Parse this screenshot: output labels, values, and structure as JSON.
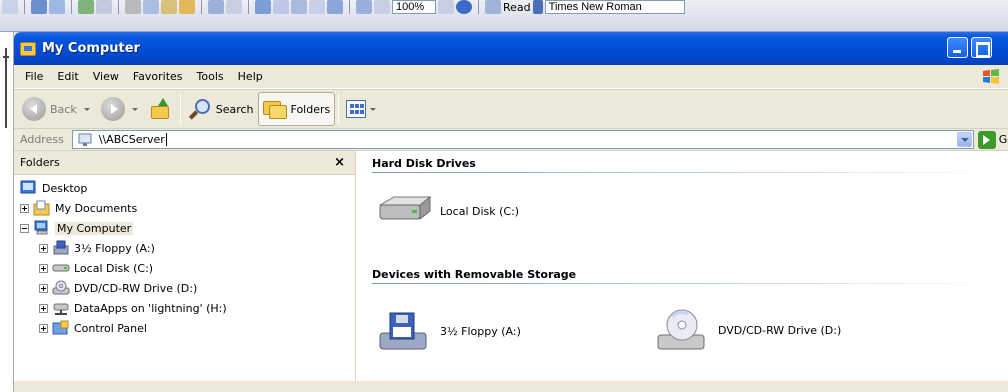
{
  "word_toolbar": {
    "zoom": "100%",
    "read_label": "Read",
    "font_box": "Times New Roman"
  },
  "window": {
    "title": "My Computer"
  },
  "menu": [
    "File",
    "Edit",
    "View",
    "Favorites",
    "Tools",
    "Help"
  ],
  "toolbar": {
    "back": "Back",
    "search": "Search",
    "folders": "Folders"
  },
  "address": {
    "label": "Address",
    "value": "\\\\ABCServer",
    "go": "Go"
  },
  "folders_pane": {
    "title": "Folders",
    "close": "×",
    "tree": [
      {
        "label": "Desktop"
      },
      {
        "label": "My Documents"
      },
      {
        "label": "My Computer"
      },
      {
        "label": "3½ Floppy (A:)"
      },
      {
        "label": "Local Disk (C:)"
      },
      {
        "label": "DVD/CD-RW Drive (D:)"
      },
      {
        "label": "DataApps on 'lightning' (H:)"
      },
      {
        "label": "Control Panel"
      }
    ]
  },
  "groups": {
    "hard_disks": {
      "title": "Hard Disk Drives",
      "items": [
        "Local Disk (C:)"
      ]
    },
    "removable": {
      "title": "Devices with Removable Storage",
      "items": [
        "3½ Floppy (A:)",
        "DVD/CD-RW Drive (D:)"
      ]
    }
  },
  "colors": {
    "titlebar": "#0150d8",
    "chrome": "#ece9d8",
    "group_header_line": "#7896d4"
  }
}
